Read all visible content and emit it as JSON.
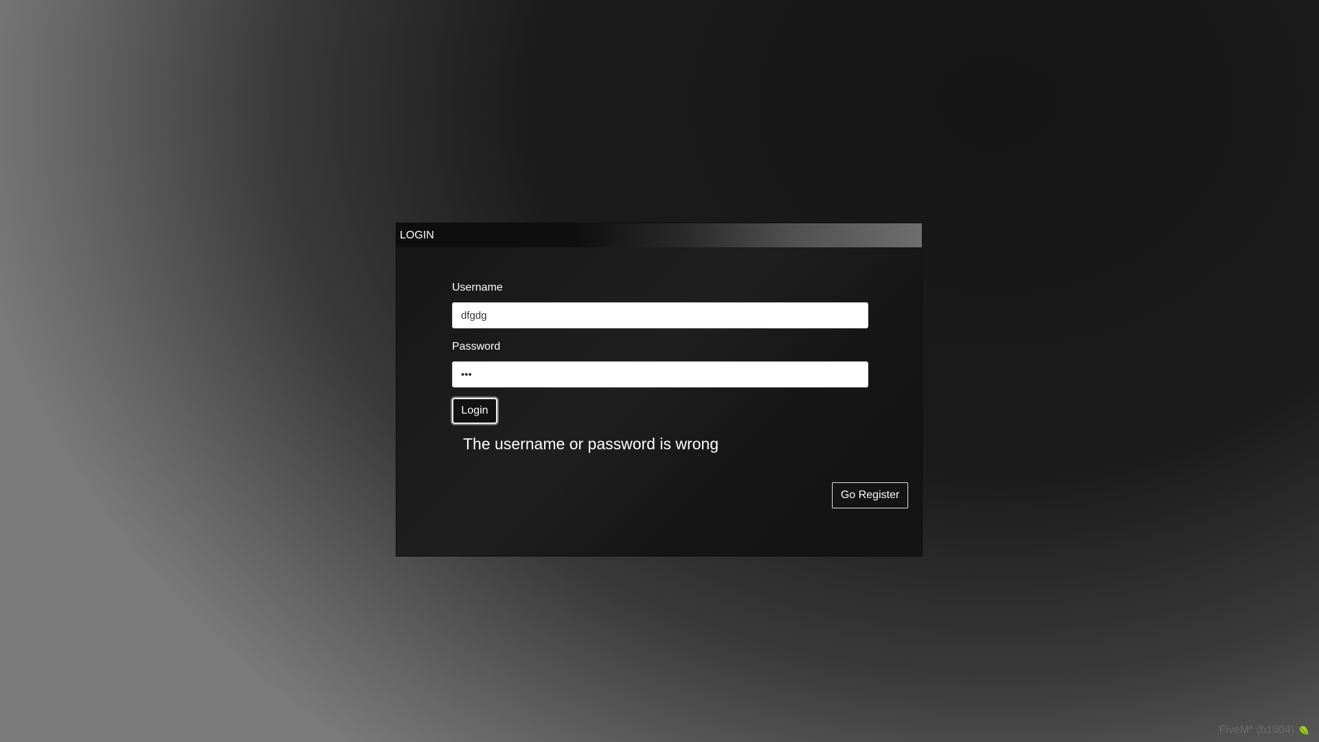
{
  "login_panel": {
    "title": "LOGIN",
    "username_label": "Username",
    "username_value": "dfgdg",
    "password_label": "Password",
    "password_value": "abc",
    "login_button": "Login",
    "error_message": "The username or password is wrong",
    "register_button": "Go Register"
  },
  "footer": {
    "version_text": "FiveM* (b1604)",
    "icon": "leaf-icon",
    "icon_color": "#9bd31b"
  }
}
